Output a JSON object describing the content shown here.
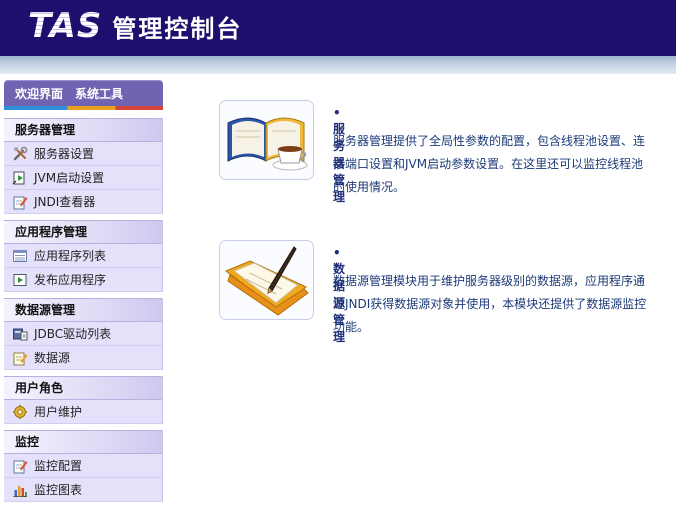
{
  "header": {
    "logo_tas": "TAS",
    "logo_title": "管理控制台",
    "colors": {
      "header_bg": "#1c0f6e",
      "sidebar_item_bg": "#e6e1fb",
      "content_text": "#1d3a78"
    }
  },
  "sidebar": {
    "tabs": [
      {
        "label": "欢迎界面"
      },
      {
        "label": "系统工具"
      }
    ],
    "groups": [
      {
        "title": "服务器管理",
        "items": [
          {
            "label": "服务器设置",
            "icon": "tools-icon"
          },
          {
            "label": "JVM启动设置",
            "icon": "launch-icon"
          },
          {
            "label": "JNDI查看器",
            "icon": "edit-document-icon"
          }
        ]
      },
      {
        "title": "应用程序管理",
        "items": [
          {
            "label": "应用程序列表",
            "icon": "list-icon"
          },
          {
            "label": "发布应用程序",
            "icon": "deploy-icon"
          }
        ]
      },
      {
        "title": "数据源管理",
        "items": [
          {
            "label": "JDBC驱动列表",
            "icon": "driver-icon"
          },
          {
            "label": "数据源",
            "icon": "datasource-icon"
          }
        ]
      },
      {
        "title": "用户角色",
        "items": [
          {
            "label": "用户维护",
            "icon": "user-gear-icon"
          }
        ]
      },
      {
        "title": "监控",
        "items": [
          {
            "label": "监控配置",
            "icon": "edit-document-icon"
          },
          {
            "label": "监控图表",
            "icon": "bar-chart-icon"
          }
        ]
      }
    ]
  },
  "main": {
    "features": [
      {
        "title": "•服务器管理",
        "icon": "book-coffee-icon",
        "desc_lines": [
          "服务器管理提供了全局性参数的配置，包含线程池设置、连",
          "接端口设置和JVM启动参数设置。在这里还可以监控线程池",
          "的使用情况。"
        ]
      },
      {
        "title": "•数据源管理",
        "icon": "folder-pen-icon",
        "desc_lines": [
          "数据源管理模块用于维护服务器级别的数据源，应用程序通",
          "过JNDI获得数据源对象并使用，本模块还提供了数据源监控",
          "功能。"
        ]
      }
    ]
  }
}
